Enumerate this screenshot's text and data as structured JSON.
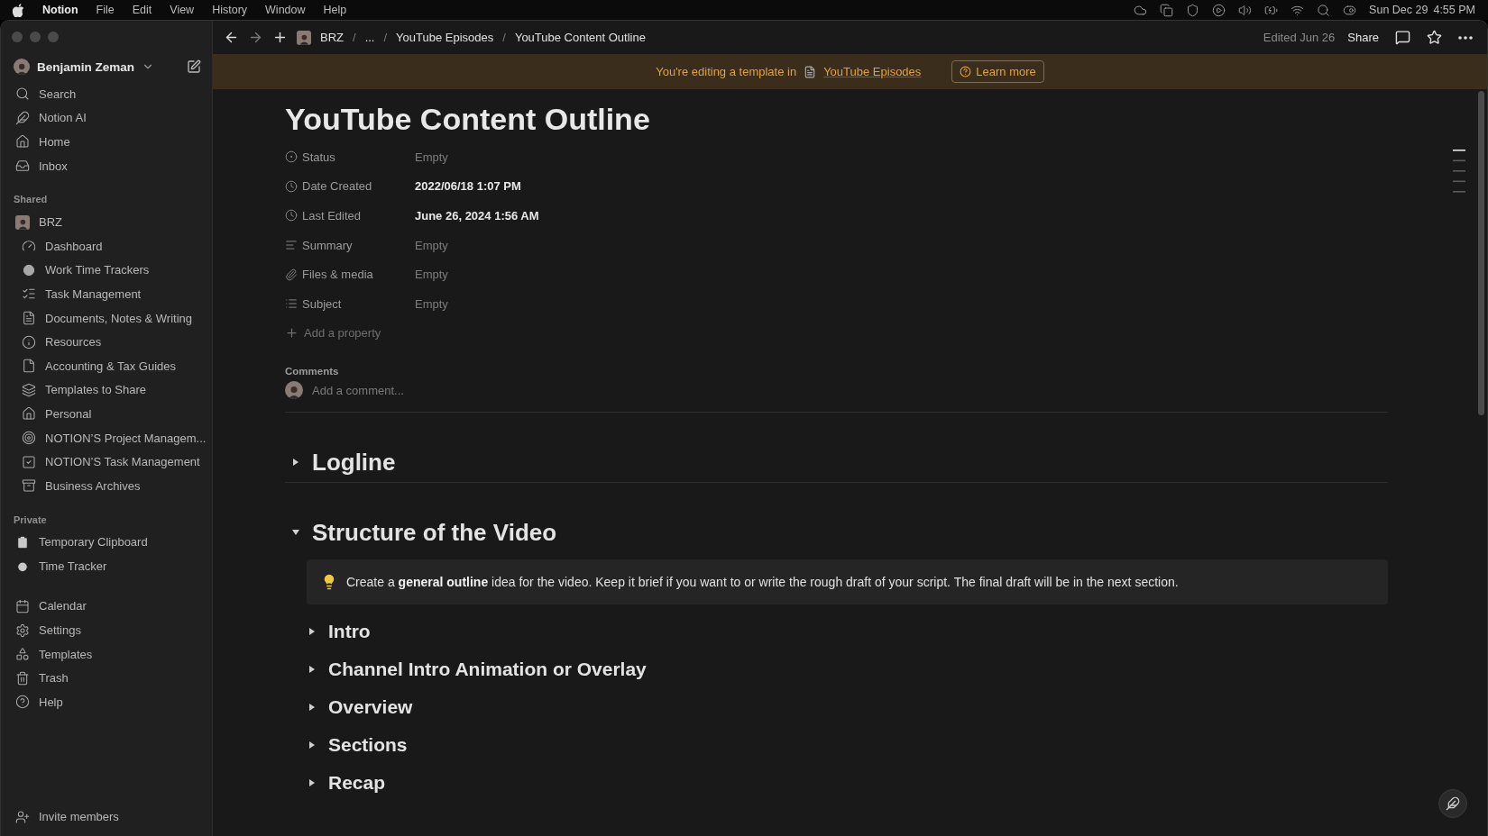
{
  "menu_bar": {
    "app": "Notion",
    "menus": [
      "File",
      "Edit",
      "View",
      "History",
      "Window",
      "Help"
    ],
    "date": "Sun Dec 29",
    "time": "4:55 PM"
  },
  "sidebar": {
    "user": "Benjamin Zeman",
    "nav": [
      {
        "label": "Search"
      },
      {
        "label": "Notion AI"
      },
      {
        "label": "Home"
      },
      {
        "label": "Inbox"
      }
    ],
    "shared": {
      "title": "Shared",
      "workspace": {
        "label": "BRZ",
        "children": [
          {
            "label": "Dashboard"
          },
          {
            "label": "Work Time Trackers"
          },
          {
            "label": "Task Management"
          },
          {
            "label": "Documents, Notes & Writing"
          },
          {
            "label": "Resources"
          },
          {
            "label": "Accounting & Tax Guides"
          },
          {
            "label": "Templates to Share"
          },
          {
            "label": "Personal"
          },
          {
            "label": "NOTION’S Project Managem..."
          },
          {
            "label": "NOTION’S Task Management"
          },
          {
            "label": "Business Archives"
          }
        ]
      }
    },
    "private": {
      "title": "Private",
      "items": [
        {
          "label": "Temporary Clipboard"
        },
        {
          "label": "Time Tracker"
        }
      ]
    },
    "tools": [
      {
        "label": "Calendar"
      },
      {
        "label": "Settings"
      },
      {
        "label": "Templates"
      },
      {
        "label": "Trash"
      },
      {
        "label": "Help"
      }
    ],
    "invite": "Invite members"
  },
  "top_bar": {
    "breadcrumbs": [
      {
        "kind": "crumb",
        "text": "BRZ"
      },
      {
        "kind": "separator",
        "text": "/"
      },
      {
        "kind": "crumb",
        "text": "..."
      },
      {
        "kind": "separator",
        "text": "/"
      },
      {
        "kind": "crumb",
        "text": "YouTube Episodes"
      },
      {
        "kind": "separator",
        "text": "/"
      },
      {
        "kind": "crumb",
        "text": "YouTube Content Outline"
      }
    ],
    "edited": "Edited Jun 26",
    "share": "Share"
  },
  "banner": {
    "text": "You're editing a template in",
    "link": "YouTube Episodes",
    "button": "Learn more"
  },
  "page": {
    "title": "YouTube Content Outline",
    "properties": [
      {
        "label": "Status",
        "value": "Empty",
        "empty": true
      },
      {
        "label": "Date Created",
        "value": "2022/06/18 1:07 PM",
        "empty": false
      },
      {
        "label": "Last Edited",
        "value": "June 26, 2024 1:56 AM",
        "empty": false
      },
      {
        "label": "Summary",
        "value": "Empty",
        "empty": true
      },
      {
        "label": "Files & media",
        "value": "Empty",
        "empty": true
      },
      {
        "label": "Subject",
        "value": "Empty",
        "empty": true
      }
    ],
    "add_property": "Add a property",
    "comments": {
      "title": "Comments",
      "placeholder": "Add a comment..."
    },
    "blocks": [
      {
        "kind": "toggle_heading",
        "text": "Logline",
        "expanded": false
      },
      {
        "kind": "toggle_heading",
        "text": "Structure of the Video",
        "expanded": true,
        "children": [
          {
            "kind": "callout",
            "text": "Create a **general outline** idea for the video. Keep it brief if you want to or write the rough draft of your script. The final draft will be in the next section."
          },
          {
            "kind": "toggle_subheading",
            "text": "Intro",
            "expanded": false
          },
          {
            "kind": "toggle_subheading",
            "text": "Channel Intro Animation or Overlay",
            "expanded": false
          },
          {
            "kind": "toggle_subheading",
            "text": "Overview",
            "expanded": false
          },
          {
            "kind": "toggle_subheading",
            "text": "Sections",
            "expanded": false
          },
          {
            "kind": "toggle_subheading",
            "text": "Recap",
            "expanded": false
          }
        ]
      }
    ]
  }
}
